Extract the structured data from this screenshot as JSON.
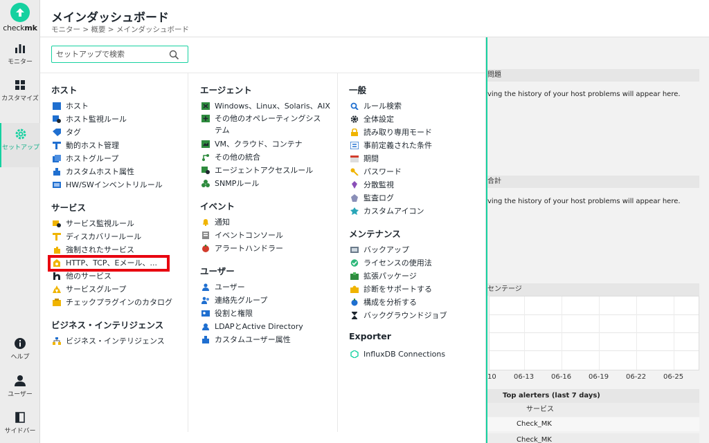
{
  "app": {
    "logo_text": "check",
    "logo_text_bold": "mk",
    "page_title": "メインダッシュボード",
    "breadcrumb": "モニター > 概要 > メインダッシュボード"
  },
  "colors": {
    "accent": "#15d1a0",
    "highlight": "#e8000f"
  },
  "nav": {
    "monitor": "モニター",
    "customize": "カスタマイズ",
    "setup": "セットアップ",
    "help": "ヘルプ",
    "user": "ユーザー",
    "sidebar": "サイドバー"
  },
  "search": {
    "placeholder": "セットアップで検索",
    "value": ""
  },
  "menu": {
    "col1": [
      {
        "topic": "ホスト",
        "items": [
          {
            "label": "ホスト",
            "icon": "host-icon"
          },
          {
            "label": "ホスト監視ルール",
            "icon": "host-rules-icon"
          },
          {
            "label": "タグ",
            "icon": "tag-icon"
          },
          {
            "label": "動的ホスト管理",
            "icon": "dynamic-host-icon"
          },
          {
            "label": "ホストグループ",
            "icon": "host-group-icon"
          },
          {
            "label": "カスタムホスト属性",
            "icon": "custom-attr-icon"
          },
          {
            "label": "HW/SWインベントリルール",
            "icon": "inventory-icon"
          }
        ]
      },
      {
        "topic": "サービス",
        "items": [
          {
            "label": "サービス監視ルール",
            "icon": "service-rules-icon"
          },
          {
            "label": "ディスカバリールール",
            "icon": "discovery-icon"
          },
          {
            "label": "強制されたサービス",
            "icon": "enforced-icon"
          },
          {
            "label": "HTTP、TCP、Eメール、...",
            "icon": "network-services-icon"
          },
          {
            "label": "他のサービス",
            "icon": "other-services-icon"
          },
          {
            "label": "サービスグループ",
            "icon": "service-group-icon"
          },
          {
            "label": "チェックプラグインのカタログ",
            "icon": "catalog-icon"
          }
        ]
      },
      {
        "topic": "ビジネス・インテリジェンス",
        "items": [
          {
            "label": "ビジネス・インテリジェンス",
            "icon": "bi-icon"
          }
        ]
      }
    ],
    "col2": [
      {
        "topic": "エージェント",
        "items": [
          {
            "label": "Windows、Linux、Solaris、AIX",
            "icon": "os-agent-icon"
          },
          {
            "label": "その他のオペレーティングシステム",
            "icon": "other-os-icon"
          },
          {
            "label": "VM、クラウド、コンテナ",
            "icon": "vm-icon"
          },
          {
            "label": "その他の統合",
            "icon": "integration-icon"
          },
          {
            "label": "エージェントアクセスルール",
            "icon": "agent-access-icon"
          },
          {
            "label": "SNMPルール",
            "icon": "snmp-icon"
          }
        ]
      },
      {
        "topic": "イベント",
        "items": [
          {
            "label": "通知",
            "icon": "bell-icon"
          },
          {
            "label": "イベントコンソール",
            "icon": "event-console-icon"
          },
          {
            "label": "アラートハンドラー",
            "icon": "alert-handler-icon"
          }
        ]
      },
      {
        "topic": "ユーザー",
        "items": [
          {
            "label": "ユーザー",
            "icon": "user-icon"
          },
          {
            "label": "連絡先グループ",
            "icon": "contact-group-icon"
          },
          {
            "label": "役割と権限",
            "icon": "roles-icon"
          },
          {
            "label": "LDAPとActive Directory",
            "icon": "ldap-icon"
          },
          {
            "label": "カスタムユーザー属性",
            "icon": "custom-user-icon"
          }
        ]
      }
    ],
    "col3": [
      {
        "topic": "一般",
        "items": [
          {
            "label": "ルール検索",
            "icon": "rule-search-icon"
          },
          {
            "label": "全体設定",
            "icon": "gear-icon"
          },
          {
            "label": "読み取り専用モード",
            "icon": "lock-icon"
          },
          {
            "label": "事前定義された条件",
            "icon": "condition-icon"
          },
          {
            "label": "期間",
            "icon": "calendar-icon"
          },
          {
            "label": "パスワード",
            "icon": "key-icon"
          },
          {
            "label": "分散監視",
            "icon": "distributed-icon"
          },
          {
            "label": "監査ログ",
            "icon": "audit-icon"
          },
          {
            "label": "カスタムアイコン",
            "icon": "custom-icon-icon"
          }
        ]
      },
      {
        "topic": "メンテナンス",
        "items": [
          {
            "label": "バックアップ",
            "icon": "backup-icon"
          },
          {
            "label": "ライセンスの使用法",
            "icon": "license-icon"
          },
          {
            "label": "拡張パッケージ",
            "icon": "package-icon"
          },
          {
            "label": "診断をサポートする",
            "icon": "diagnostics-icon"
          },
          {
            "label": "構成を分析する",
            "icon": "analyze-icon"
          },
          {
            "label": "バックグラウンドジョブ",
            "icon": "hourglass-icon"
          }
        ]
      },
      {
        "topic": "Exporter",
        "items": [
          {
            "label": "InfluxDB Connections",
            "icon": "influxdb-icon"
          }
        ]
      }
    ]
  },
  "dashboard": {
    "bar1": "問題",
    "msg1": "ving the history of your host problems will appear here.",
    "bar2": "合計",
    "msg2": "ving the history of your host problems will appear here.",
    "bar3": "センテージ",
    "ticks": [
      "10",
      "06-13",
      "06-16",
      "06-19",
      "06-22",
      "06-25"
    ],
    "alerters_title": "Top alerters (last 7 days)",
    "alerters_header": "サービス",
    "alerters_rows": [
      "Check_MK",
      "Check_MK"
    ]
  }
}
